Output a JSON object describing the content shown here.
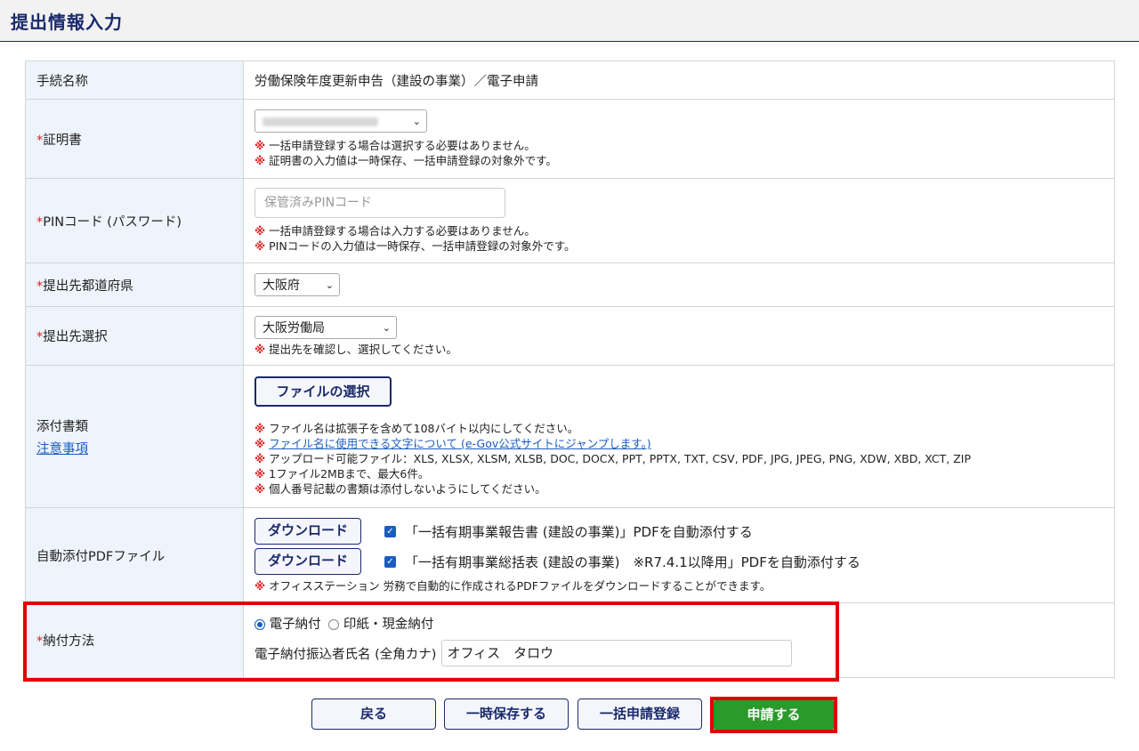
{
  "header": {
    "title": "提出情報入力"
  },
  "rows": {
    "procedure": {
      "label": "手続名称",
      "value": "労働保険年度更新申告（建設の事業）／電子申請"
    },
    "certificate": {
      "required": "*",
      "label": "証明書",
      "note_mark": "※",
      "notes": [
        "一括申請登録する場合は選択する必要はありません。",
        "証明書の入力値は一時保存、一括申請登録の対象外です。"
      ]
    },
    "pin": {
      "required": "*",
      "label": "PINコード (パスワード)",
      "placeholder": "保管済みPINコード",
      "notes": [
        "一括申請登録する場合は入力する必要はありません。",
        "PINコードの入力値は一時保存、一括申請登録の対象外です。"
      ]
    },
    "prefecture": {
      "required": "*",
      "label": "提出先都道府県",
      "selected": "大阪府"
    },
    "destination": {
      "required": "*",
      "label": "提出先選択",
      "selected": "大阪労働局",
      "note": "提出先を確認し、選択してください。"
    },
    "attachments": {
      "label": "添付書類",
      "link": "注意事項",
      "button": "ファイルの選択",
      "notes": [
        "ファイル名は拡張子を含めて108バイト以内にしてください。",
        "ファイル名に使用できる文字について (e-Gov公式サイトにジャンプします。)",
        "アップロード可能ファイル：XLS, XLSX, XLSM, XLSB, DOC, DOCX, PPT, PPTX, TXT, CSV, PDF, JPG, JPEG, PNG, XDW, XBD, XCT, ZIP",
        "1ファイル2MBまで、最大6件。",
        "個人番号記載の書類は添付しないようにしてください。"
      ]
    },
    "auto_pdf": {
      "label": "自動添付PDFファイル",
      "items": [
        {
          "button": "ダウンロード",
          "checked": true,
          "text": "「一括有期事業報告書 (建設の事業)」PDFを自動添付する"
        },
        {
          "button": "ダウンロード",
          "checked": true,
          "text": "「一括有期事業総括表 (建設の事業)　※R7.4.1以降用」PDFを自動添付する"
        }
      ],
      "note": "オフィスステーション 労務で自動的に作成されるPDFファイルをダウンロードすることができます。"
    },
    "payment": {
      "required": "*",
      "label": "納付方法",
      "option_electronic": "電子納付",
      "option_paper": "印紙・現金納付",
      "payer_label": "電子納付振込者氏名 (全角カナ)",
      "payer_value": "オフィス　タロウ"
    }
  },
  "actions": {
    "back": "戻る",
    "save": "一時保存する",
    "bulk": "一括申請登録",
    "submit": "申請する"
  },
  "colors": {
    "accent": "#1a2a6c",
    "highlight": "#e00000",
    "submit": "#2a9a2a",
    "label_bg": "#eef4fb"
  }
}
